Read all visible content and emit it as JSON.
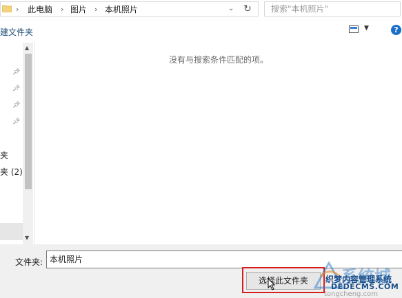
{
  "address_bar": {
    "breadcrumbs": [
      "此电脑",
      "图片",
      "本机照片"
    ],
    "search_placeholder": "搜索\"本机照片\""
  },
  "toolbar": {
    "new_folder_label": "建文件夹",
    "help_label": "?"
  },
  "nav_pane": {
    "items": [
      {
        "label": "夹"
      },
      {
        "label": "夹 (2)"
      }
    ]
  },
  "main": {
    "empty_message": "没有与搜索条件匹配的项。"
  },
  "bottom": {
    "folder_label": "文件夹:",
    "folder_value": "本机照片",
    "select_button_label": "选择此文件夹"
  },
  "watermark": {
    "brand": "系统城",
    "line1": "织梦内容管理系统",
    "line2": "DEDECMS.COM",
    "line3": "tongcheng.com"
  },
  "colors": {
    "accent": "#1a6fc9",
    "highlight": "#d62020"
  }
}
